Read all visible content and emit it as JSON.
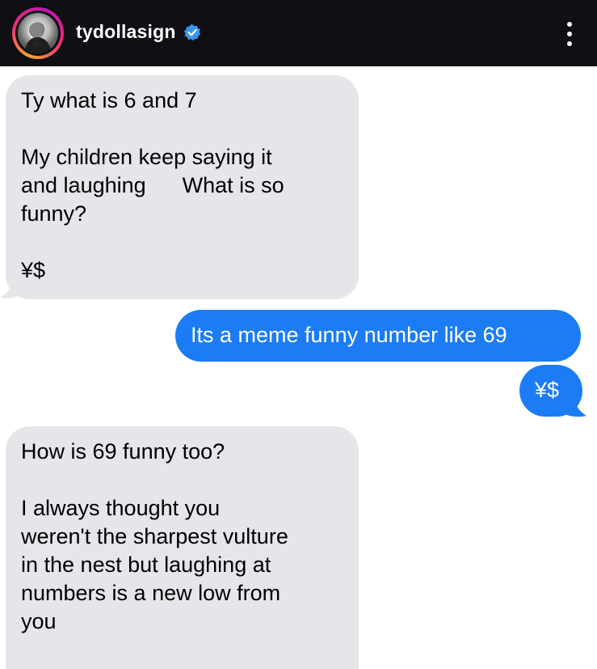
{
  "header": {
    "username": "tydollasign",
    "verified": true,
    "avatar_icon": "profile-photo",
    "menu_icon": "more-vertical-icon",
    "colors": {
      "background": "#0f0f14",
      "text": "#ffffff",
      "verified": "#3797f0"
    }
  },
  "messages": [
    {
      "side": "received",
      "lines": [
        "Ty what is 6 and 7",
        "",
        "My children keep saying it",
        "and laughing      What is so",
        "funny?",
        "",
        "¥$"
      ]
    },
    {
      "side": "sent",
      "lines": [
        "Its a meme funny number like 69"
      ]
    },
    {
      "side": "sent",
      "lines": [
        "¥$"
      ]
    },
    {
      "side": "received",
      "lines": [
        "How is 69 funny too?",
        "",
        "I always thought you",
        "weren't the sharpest vulture",
        "in the nest but laughing at",
        "numbers is a new low from",
        "you"
      ]
    }
  ],
  "colors": {
    "received_bubble": "#e5e5ea",
    "sent_bubble": "#1b7cf6"
  }
}
